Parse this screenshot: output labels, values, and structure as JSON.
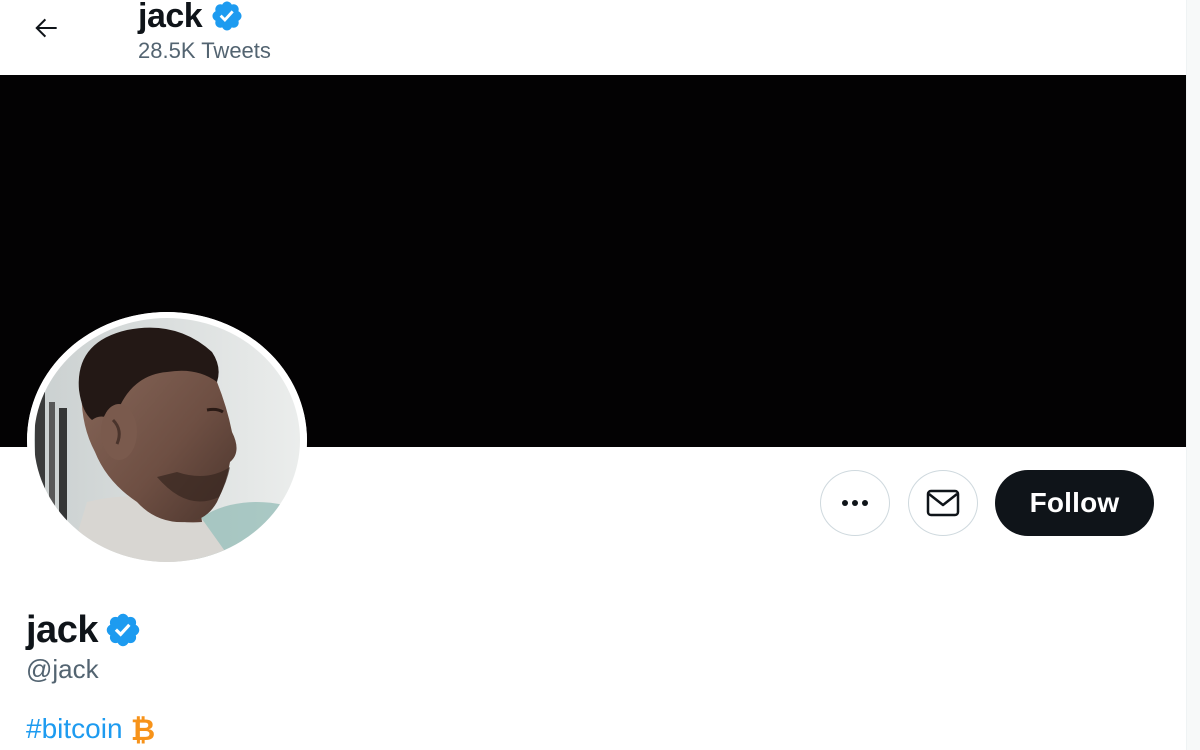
{
  "header": {
    "name": "jack",
    "tweet_count": "28.5K Tweets"
  },
  "profile": {
    "name": "jack",
    "handle": "@jack",
    "verified": true,
    "bio": {
      "hashtag": "#bitcoin",
      "emoji_icon": "bitcoin-icon"
    }
  },
  "actions": {
    "more_icon": "more-icon",
    "message_icon": "mail-icon",
    "follow_label": "Follow"
  },
  "colors": {
    "accent": "#1d9bf0",
    "text_primary": "#0f1419",
    "text_secondary": "#536471",
    "banner": "#030203",
    "bitcoin": "#f7931a"
  }
}
